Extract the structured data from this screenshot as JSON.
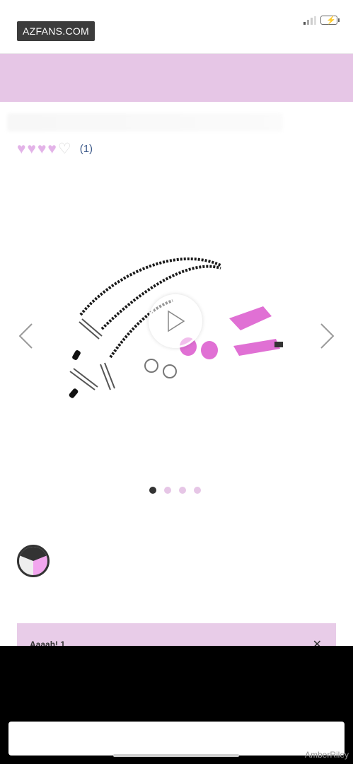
{
  "watermark": {
    "top_label": "AZFANS.COM",
    "bottom_label": "AmberRiley"
  },
  "product": {
    "rating": {
      "filled": 4,
      "max": 5,
      "count_text": "(1)"
    },
    "carousel": {
      "slide_count": 4,
      "active_index": 0
    }
  },
  "notice": {
    "text": "Aaaah! 1",
    "close_label": "✕"
  },
  "colors": {
    "accent": "#e6c6e6",
    "notice_bg": "#e8cce8",
    "product_pink": "#e070d4"
  },
  "icons": [
    "battery-icon",
    "signal-icon",
    "heart-icon",
    "chevron-left-icon",
    "chevron-right-icon",
    "play-icon",
    "close-icon"
  ]
}
